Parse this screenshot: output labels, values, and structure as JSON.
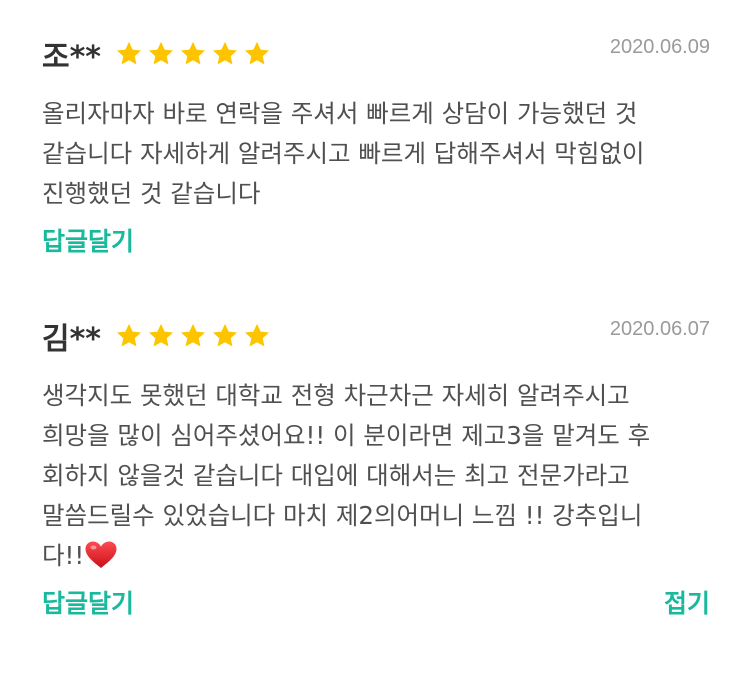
{
  "reviews": [
    {
      "author": "조**",
      "rating": 5,
      "date": "2020.06.09",
      "text": "올리자마자 바로 연락을 주셔서 빠르게 상담이 가능했던 것\n같습니다 자세하게 알려주시고 빠르게 답해주셔서 막힘없이\n진행했던 것 같습니다",
      "reply_label": "답글달기"
    },
    {
      "author": "김**",
      "rating": 5,
      "date": "2020.06.07",
      "text": "생각지도 못했던 대학교 전형 차근차근 자세히 알려주시고\n희망을 많이 심어주셨어요!! 이 분이라면 제고3을 맡겨도 후\n회하지 않을것 같습니다 대입에 대해서는 최고 전문가라고\n말씀드릴수 있었습니다 마치 제2의어머니 느낌 !! 강추입니\n다!!",
      "reply_label": "답글달기",
      "collapse_label": "접기"
    }
  ],
  "colors": {
    "star": "#ffc400",
    "accent": "#18b99c",
    "heart": "#e0161f"
  },
  "icons": {
    "star": "star-icon",
    "heart": "red-heart-icon"
  }
}
